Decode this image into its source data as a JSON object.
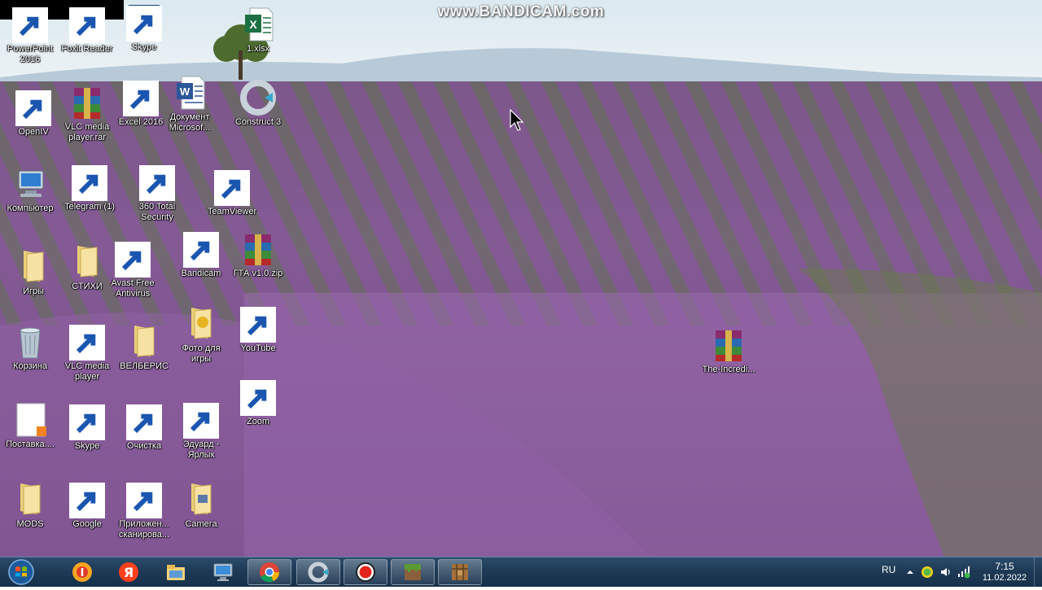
{
  "watermark": "www.BANDICAM.com",
  "desktop": {
    "icons": [
      {
        "id": "powerpoint",
        "label": "PowerPoint\n2016",
        "icon": "powerpoint-icon"
      },
      {
        "id": "foxit",
        "label": "Foxit Reader",
        "icon": "pdf-icon"
      },
      {
        "id": "skype-top",
        "label": "Skype",
        "icon": "uno-icon"
      },
      {
        "id": "xlsx",
        "label": "1.xlsx",
        "icon": "excel-file-icon"
      },
      {
        "id": "openiv",
        "label": "OpenIV",
        "icon": "openiv-icon"
      },
      {
        "id": "vlc-rar",
        "label": "VLC media\nplayer.rar",
        "icon": "winrar-icon"
      },
      {
        "id": "excel",
        "label": "Excel 2016",
        "icon": "excel-icon"
      },
      {
        "id": "document",
        "label": "Документ\nMicrosof...",
        "icon": "word-doc-icon"
      },
      {
        "id": "construct",
        "label": "Construct 3",
        "icon": "construct-icon"
      },
      {
        "id": "computer",
        "label": "Компьютер",
        "icon": "computer-icon"
      },
      {
        "id": "telegram",
        "label": "Telegram (1)",
        "icon": "telegram-icon"
      },
      {
        "id": "360",
        "label": "360 Total\nSecurity",
        "icon": "360-security-icon"
      },
      {
        "id": "teamviewer",
        "label": "TeamViewer",
        "icon": "teamviewer-icon"
      },
      {
        "id": "games",
        "label": "Игры",
        "icon": "folder-icon"
      },
      {
        "id": "poems",
        "label": "СТИХИ",
        "icon": "folder-icon"
      },
      {
        "id": "avast",
        "label": "Avast Free\nAntivirus",
        "icon": "avast-icon"
      },
      {
        "id": "bandicam",
        "label": "Bandicam",
        "icon": "bandicam-icon"
      },
      {
        "id": "gta",
        "label": "ГТА v1.0.zip",
        "icon": "winrar-icon"
      },
      {
        "id": "recycle",
        "label": "Корзина",
        "icon": "recycle-bin-icon"
      },
      {
        "id": "vlc",
        "label": "VLC media\nplayer",
        "icon": "vlc-icon"
      },
      {
        "id": "wildberries",
        "label": "ВЕЛБЕРИС",
        "icon": "folder-icon"
      },
      {
        "id": "photos",
        "label": "Фото для\nигры",
        "icon": "folder-icon"
      },
      {
        "id": "youtube",
        "label": "YouTube",
        "icon": "youtube-icon"
      },
      {
        "id": "incredi",
        "label": "The-Incredi...",
        "icon": "winrar-icon"
      },
      {
        "id": "postavka",
        "label": "Поставка....",
        "icon": "blank-file-icon"
      },
      {
        "id": "skype",
        "label": "Skype",
        "icon": "skype-icon"
      },
      {
        "id": "cleanup",
        "label": "Очистка",
        "icon": "broom-icon"
      },
      {
        "id": "eduard",
        "label": "Эдуард -\nЯрлык",
        "icon": "folder-icon"
      },
      {
        "id": "zoom",
        "label": "Zoom",
        "icon": "zoom-icon"
      },
      {
        "id": "mods",
        "label": "MODS",
        "icon": "folder-icon"
      },
      {
        "id": "google",
        "label": "Google",
        "icon": "chrome-icon"
      },
      {
        "id": "scan",
        "label": "Приложен...\nсканирова...",
        "icon": "scanner-icon"
      },
      {
        "id": "camera",
        "label": "Camera",
        "icon": "folder-icon"
      }
    ]
  },
  "taskbar": {
    "start_icon": "windows-start-icon",
    "pinned": [
      {
        "id": "yandex-browser",
        "icon": "yandex-browser-icon",
        "open": false
      },
      {
        "id": "yandex",
        "icon": "yandex-icon",
        "open": false
      },
      {
        "id": "explorer",
        "icon": "explorer-folder-icon",
        "open": false
      },
      {
        "id": "monitor",
        "icon": "monitor-icon",
        "open": false
      },
      {
        "id": "chrome",
        "icon": "chrome-icon",
        "open": true
      },
      {
        "id": "construct",
        "icon": "construct-icon",
        "open": true
      },
      {
        "id": "bandicam",
        "icon": "bandicam-icon",
        "open": true
      },
      {
        "id": "minecraft",
        "icon": "minecraft-grass-icon",
        "open": true
      },
      {
        "id": "minecraft-table",
        "icon": "crafting-table-icon",
        "open": true
      }
    ],
    "tray": {
      "language": "RU",
      "time": "7:15",
      "date": "11.02.2022"
    }
  }
}
